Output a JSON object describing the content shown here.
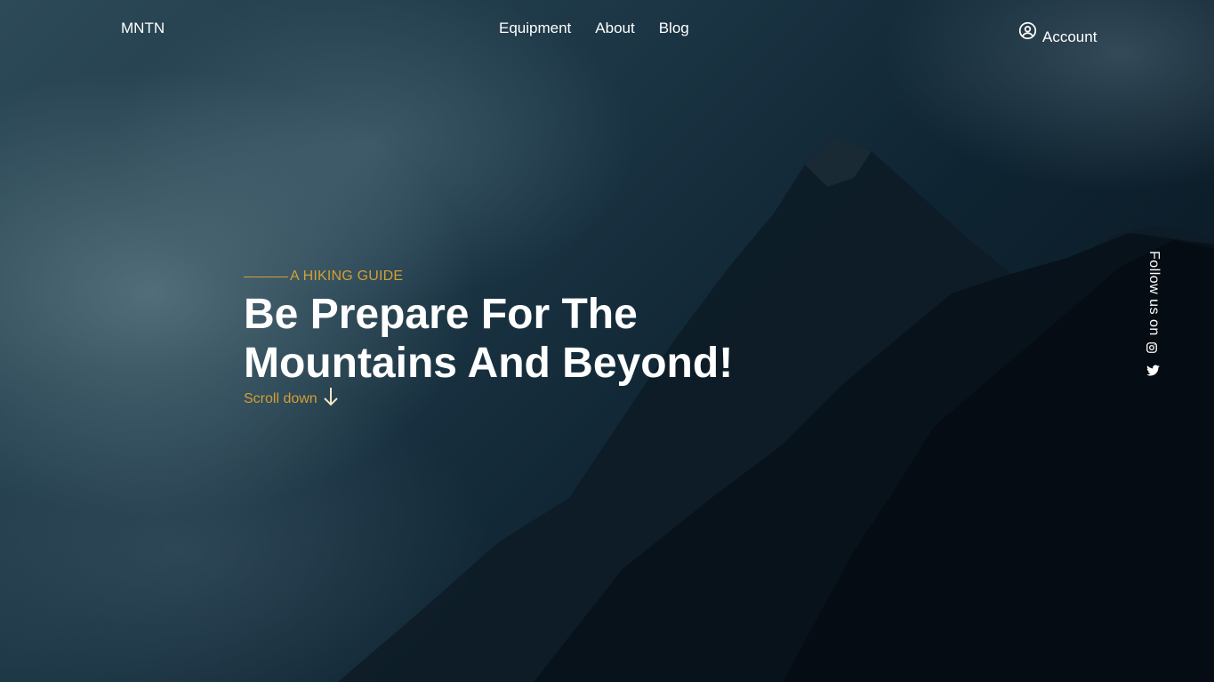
{
  "header": {
    "logo": "MNTN",
    "nav": [
      {
        "label": "Equipment"
      },
      {
        "label": "About"
      },
      {
        "label": "Blog"
      }
    ],
    "account_label": "Account"
  },
  "hero": {
    "eyebrow": "A HIKING GUIDE",
    "title_line1": "Be Prepare For The",
    "title_line2": "Mountains And Beyond!",
    "scroll_label": "Scroll down"
  },
  "social": {
    "label": "Follow us on",
    "icons": [
      "instagram-icon",
      "twitter-icon"
    ]
  },
  "colors": {
    "accent": "#d3a035",
    "text": "#ffffff",
    "background": "#0b1a24"
  }
}
